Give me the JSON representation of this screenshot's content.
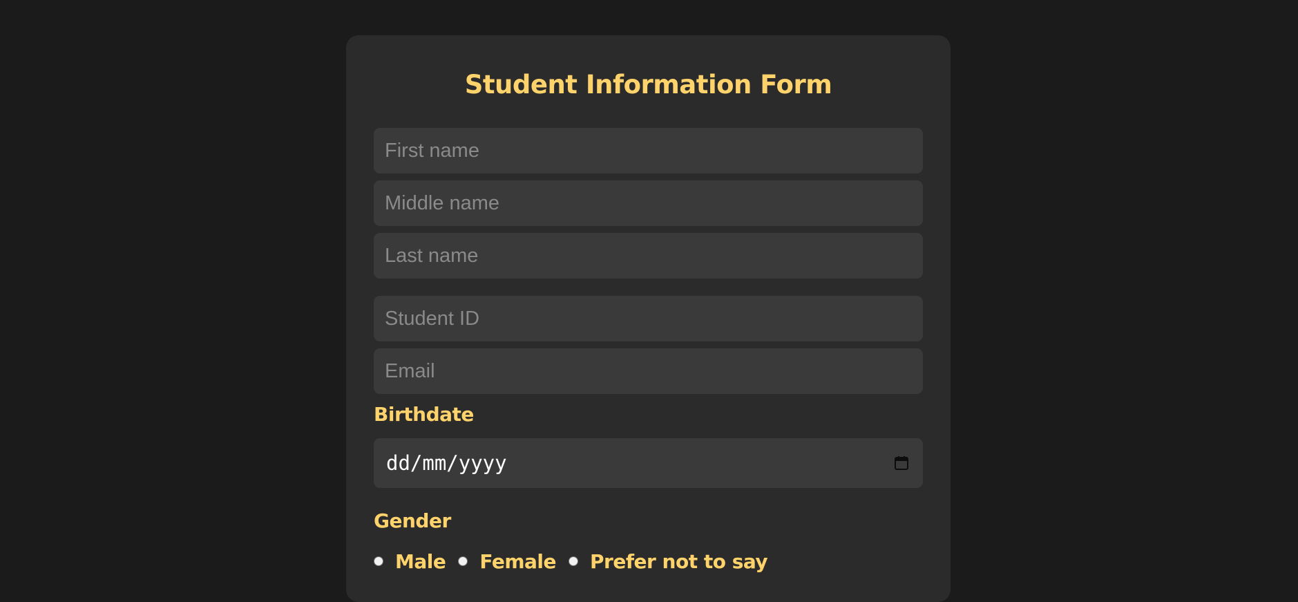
{
  "form": {
    "title": "Student Information Form",
    "fields": {
      "first_name_placeholder": "First name",
      "middle_name_placeholder": "Middle name",
      "last_name_placeholder": "Last name",
      "student_id_placeholder": "Student ID",
      "email_placeholder": "Email"
    },
    "birthdate": {
      "label": "Birthdate",
      "value_format": "dd/mm/yyyy",
      "icon": "calendar-icon"
    },
    "gender": {
      "label": "Gender",
      "options": [
        "Male",
        "Female",
        "Prefer not to say"
      ]
    }
  },
  "colors": {
    "page_bg": "#1b1b1b",
    "card_bg": "#2b2b2b",
    "field_bg": "#3a3a3a",
    "accent": "#ffd36b",
    "placeholder": "#8a8a8a"
  }
}
